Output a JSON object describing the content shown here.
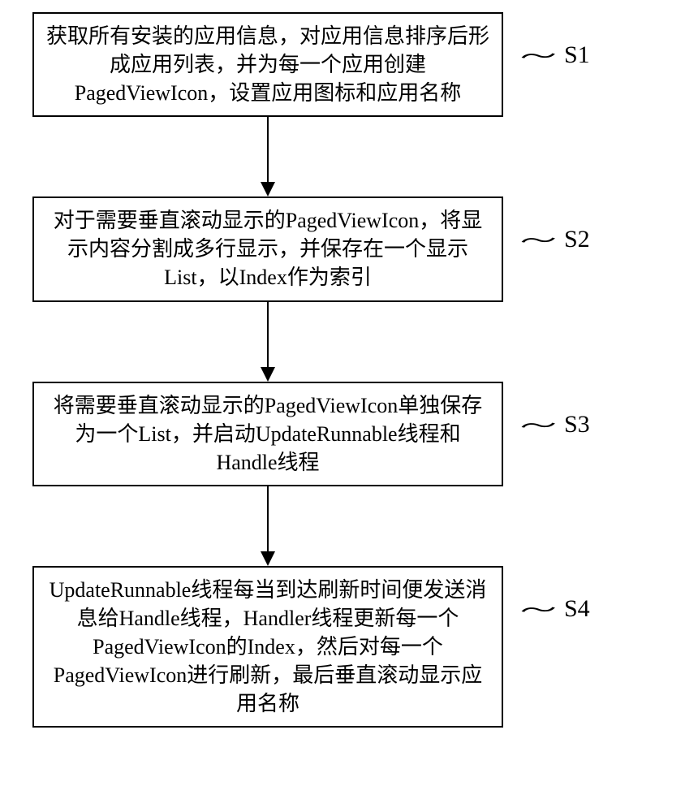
{
  "steps": [
    {
      "label": "S1",
      "text": "获取所有安装的应用信息，对应用信息排序后形成应用列表，并为每一个应用创建PagedViewIcon，设置应用图标和应用名称",
      "arrow_after": true,
      "arrow_height": 80
    },
    {
      "label": "S2",
      "text": "对于需要垂直滚动显示的PagedViewIcon，将显示内容分割成多行显示，并保存在一个显示List，以Index作为索引",
      "arrow_after": true,
      "arrow_height": 80
    },
    {
      "label": "S3",
      "text": "将需要垂直滚动显示的PagedViewIcon单独保存为一个List，并启动UpdateRunnable线程和Handle线程",
      "arrow_after": true,
      "arrow_height": 80
    },
    {
      "label": "S4",
      "text": "UpdateRunnable线程每当到达刷新时间便发送消息给Handle线程，Handler线程更新每一个PagedViewIcon的Index，然后对每一个PagedViewIcon进行刷新，最后垂直滚动显示应用名称",
      "arrow_after": false,
      "arrow_height": 0
    }
  ]
}
